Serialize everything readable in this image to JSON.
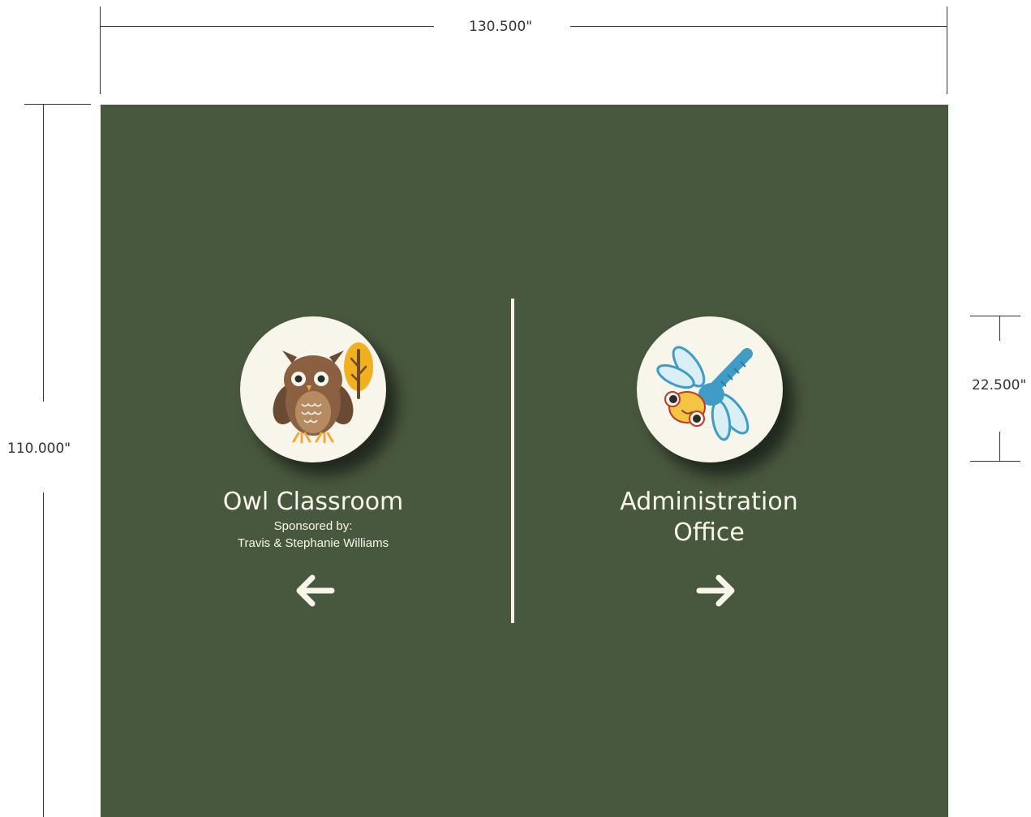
{
  "dimensions": {
    "width_label": "130.500\"",
    "height_label": "110.000\"",
    "badge_label": "22.500\""
  },
  "colors": {
    "panel": "#48583e",
    "badge": "#f8f5eb",
    "text": "#f8f5eb",
    "dimension_lines": "#333333"
  },
  "left_sign": {
    "icon": "owl-icon",
    "title": "Owl Classroom",
    "sponsor_line1": "Sponsored by:",
    "sponsor_line2": "Travis & Stephanie Williams",
    "arrow": "arrow-left-icon"
  },
  "right_sign": {
    "icon": "dragonfly-icon",
    "title_line1": "Administration",
    "title_line2": "Office",
    "arrow": "arrow-right-icon"
  }
}
